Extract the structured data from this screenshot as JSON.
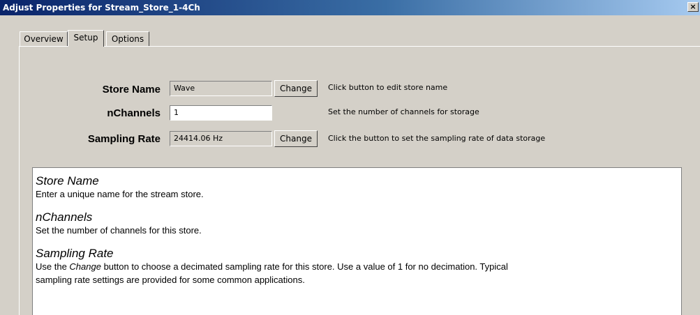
{
  "window": {
    "title": "Adjust Properties for Stream_Store_1-4Ch",
    "close_glyph": "×"
  },
  "tabs": [
    {
      "label": "Overview",
      "active": false
    },
    {
      "label": "Setup",
      "active": true
    },
    {
      "label": "Options",
      "active": false
    }
  ],
  "fields": {
    "store_name": {
      "label": "Store Name",
      "value": "Wave",
      "button": "Change",
      "hint": "Click button to edit store name"
    },
    "nchannels": {
      "label": "nChannels",
      "value": "1",
      "hint": "Set the number of channels for storage"
    },
    "sampling_rate": {
      "label": "Sampling Rate",
      "value": "24414.06 Hz",
      "button": "Change",
      "hint": "Click the button to set the sampling rate of data storage"
    }
  },
  "help": {
    "store_name_title": "Store Name",
    "store_name_text": "Enter a unique name for the stream store.",
    "nchannels_title": "nChannels",
    "nchannels_text": "Set the number of channels for this store.",
    "sampling_rate_title": "Sampling Rate",
    "sampling_rate_text_1": "Use the ",
    "sampling_rate_text_em": "Change",
    "sampling_rate_text_2": " button to choose a decimated sampling rate for this store. Use a value of 1 for no decimation. Typical",
    "sampling_rate_text_3": "sampling rate settings are provided for some common applications."
  }
}
